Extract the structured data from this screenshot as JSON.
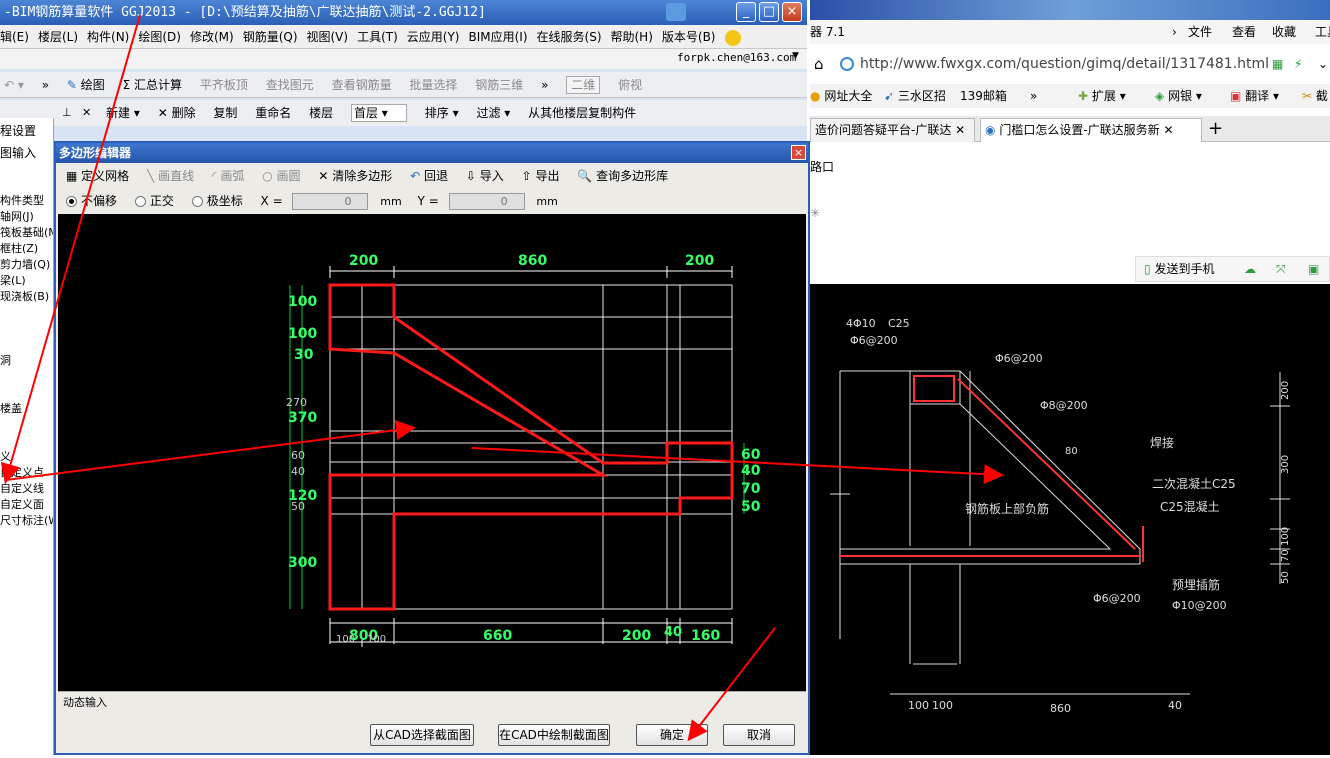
{
  "app": {
    "title": "-BIM钢筋算量软件 GGJ2013 - [D:\\预结算及抽筋\\广联达抽筋\\测试-2.GGJ12]",
    "menu": [
      "辑(E)",
      "楼层(L)",
      "构件(N)",
      "绘图(D)",
      "修改(M)",
      "钢筋量(Q)",
      "视图(V)",
      "工具(T)",
      "云应用(Y)",
      "BIM应用(I)",
      "在线服务(S)",
      "帮助(H)",
      "版本号(B)"
    ],
    "account": "forpk.chen@163.com",
    "toolbar1": [
      "绘图",
      "Σ 汇总计算",
      "平齐板顶",
      "查找图元",
      "查看钢筋量",
      "批量选择",
      "钢筋三维"
    ],
    "toolbar1_view": [
      "二维",
      "俯视"
    ],
    "toolbar2": [
      "新建",
      "删除",
      "复制",
      "重命名",
      "楼层",
      "首层",
      "排序",
      "过滤",
      "从其他楼层复制构件"
    ],
    "left_panel": {
      "items": [
        "程设置",
        "图输入",
        "构件类型",
        "轴网(J)",
        "筏板基础(M)",
        "框柱(Z)",
        "剪力墙(Q)",
        "梁(L)",
        "现浇板(B)",
        "洞",
        "楼盖",
        "义",
        "自定义点",
        "自定义线",
        "自定义面",
        "尺寸标注(W)"
      ]
    }
  },
  "dialog": {
    "title": "多边形编辑器",
    "close": "×",
    "toolbar1": [
      "定义网格",
      "画直线",
      "画弧",
      "画圆",
      "清除多边形",
      "回退",
      "导入",
      "导出",
      "查询多边形库"
    ],
    "modes": [
      "不偏移",
      "正交",
      "极坐标"
    ],
    "x_label": "X =",
    "x_value": "0",
    "y_label": "Y =",
    "y_value": "0",
    "unit": "mm",
    "dynamic_input": "动态输入",
    "buttons": {
      "from_cad": "从CAD选择截面图",
      "draw_cad": "在CAD中绘制截面图",
      "ok": "确定",
      "cancel": "取消"
    },
    "canvas": {
      "top_dims": [
        "200",
        "860",
        "200"
      ],
      "bottom_dims": [
        "800",
        "660",
        "200",
        "40",
        "160"
      ],
      "bottom_small": [
        "100",
        "100",
        "660",
        "200",
        "40",
        "160"
      ],
      "left_green": [
        "100",
        "100",
        "30",
        "370",
        "120",
        "300"
      ],
      "left_white": [
        "270",
        "60",
        "40",
        "50"
      ],
      "right_dims": [
        "60",
        "40",
        "70",
        "50"
      ]
    }
  },
  "browser": {
    "title_fragment": "器 7.1",
    "menu": [
      "文件",
      "查看",
      "收藏",
      "工具"
    ],
    "url": "http://www.fwxgx.com/question/gimq/detail/1317481.html",
    "favorites": [
      "网址大全",
      "三水区招",
      "139邮箱",
      "扩展",
      "网银",
      "翻译",
      "截"
    ],
    "tabs": [
      "造价问题答疑平台-广联达",
      "门槛口怎么设置-广联达服务新"
    ],
    "page_text": "路口",
    "send_to_phone": "发送到手机",
    "drawing": {
      "labels": [
        "4Φ10",
        "C25",
        "Φ6@200",
        "Φ6@200",
        "Φ8@200",
        "80",
        "焊接",
        "二次混凝土C25",
        "C25混凝土",
        "钢筋板上部负筋",
        "预埋插筋",
        "Φ10@200",
        "Φ6@200"
      ],
      "dims_right": [
        "200",
        "300",
        "100",
        "70",
        "50"
      ],
      "dims_bottom": [
        "100",
        "100",
        "860",
        "40"
      ]
    }
  }
}
